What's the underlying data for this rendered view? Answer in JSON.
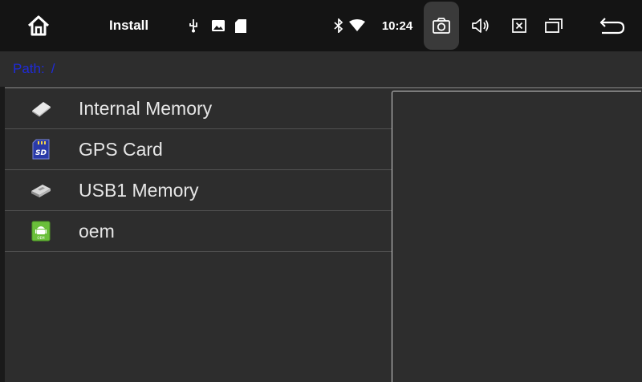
{
  "statusbar": {
    "title": "Install",
    "time": "10:24",
    "icons": [
      "home-icon",
      "usb-icon",
      "image-icon",
      "sd-card-icon",
      "bluetooth-icon",
      "wifi-icon",
      "camera-icon",
      "volume-icon",
      "close-box-icon",
      "recent-apps-icon",
      "back-icon"
    ]
  },
  "path": {
    "label": "Path:",
    "value": "/"
  },
  "files": [
    {
      "label": "Internal Memory",
      "icon": "internal-memory-icon"
    },
    {
      "label": "GPS Card",
      "icon": "sd-card-icon"
    },
    {
      "label": "USB1 Memory",
      "icon": "usb-drive-icon"
    },
    {
      "label": "oem",
      "icon": "android-oem-icon"
    }
  ],
  "colors": {
    "path_text": "#1f2bd9",
    "background": "#2d2d2d",
    "statusbar": "#141414"
  }
}
